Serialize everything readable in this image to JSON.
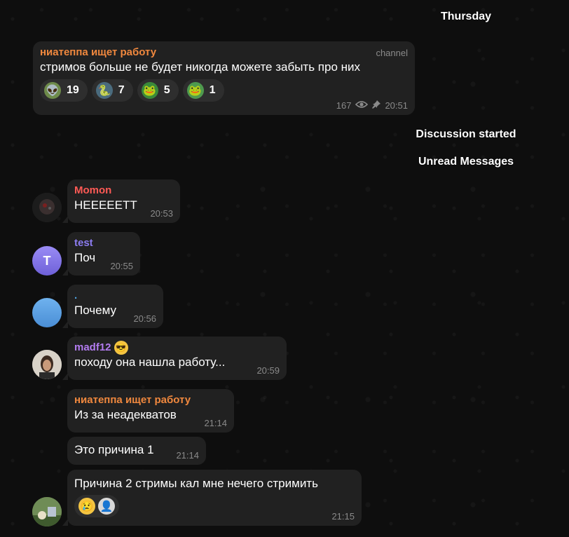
{
  "service": {
    "date": "Thursday",
    "discussion": "Discussion started",
    "unread": "Unread Messages"
  },
  "post": {
    "author": "ниатеппа ищет работу",
    "tag": "channel",
    "text": "стримов больше не будет никогда можете забыть про них",
    "views": "167",
    "time": "20:51",
    "reactions": [
      {
        "icon": "alien-sticker-emoji",
        "count": "19"
      },
      {
        "icon": "snake-sticker-emoji",
        "count": "7"
      },
      {
        "icon": "pepe-frog-emoji",
        "count": "5"
      },
      {
        "icon": "pepe-face-emoji",
        "count": "1"
      }
    ]
  },
  "messages": [
    {
      "author": "Momon",
      "text": "НЕЕЕЕЕТТ",
      "time": "20:53",
      "author_color": "#ff5a55"
    },
    {
      "author": "test",
      "avatar_letter": "T",
      "text": "Поч",
      "time": "20:55",
      "author_color": "#8c7cf0"
    },
    {
      "author": ".",
      "text": "Почему",
      "time": "20:56",
      "author_color": "#4fa3e0"
    },
    {
      "author": "madf12",
      "text": "походу она нашла работу...",
      "time": "20:59",
      "author_color": "#b37cf0"
    },
    {
      "author": "ниатеппа ищет работу",
      "text": "Из за неадекватов",
      "time": "21:14",
      "author_color": "#f0883e"
    },
    {
      "text": "Это причина 1",
      "time": "21:14"
    },
    {
      "text": "Причина 2 стримы кал мне нечего стримить",
      "time": "21:15",
      "reactions": [
        {
          "icon": "crying-face-emoji"
        },
        {
          "icon": "user-sticker-emoji"
        }
      ]
    }
  ],
  "colors": {
    "bubble": "#212121",
    "background": "#0e0e0e",
    "channel_author": "#f0883e"
  }
}
